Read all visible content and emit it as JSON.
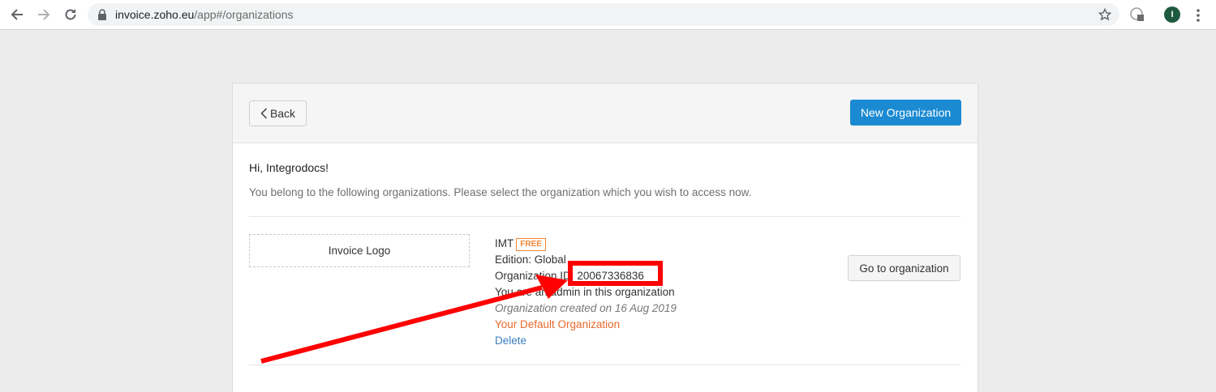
{
  "browser": {
    "url_host": "invoice.zoho.eu",
    "url_path": "/app#/organizations",
    "profile_initial": "I",
    "icons": [
      "back-arrow-icon",
      "forward-arrow-icon",
      "reload-icon",
      "lock-icon",
      "star-icon",
      "extension-icon",
      "menu-dots-icon"
    ]
  },
  "header": {
    "back_label": "Back",
    "new_org_label": "New Organization"
  },
  "main": {
    "greeting": "Hi, Integrodocs!",
    "subtitle": "You belong to the following organizations. Please select the organization which you wish to access now."
  },
  "org": {
    "logo_placeholder": "Invoice Logo",
    "name": "IMT",
    "plan_badge": "FREE",
    "edition": "Edition: Global",
    "id_label": "Organization ID:",
    "id_value": "20067336836",
    "role": "You are an admin in this organization",
    "created": "Organization created on 16 Aug 2019",
    "default_label": "Your Default Organization",
    "delete_label": "Delete",
    "go_label": "Go to organization"
  },
  "colors": {
    "primary": "#1b8ad2",
    "badge": "#f0883a",
    "default_org": "#e8692c",
    "link": "#3a7fc1",
    "annotation": "#ff0000"
  }
}
